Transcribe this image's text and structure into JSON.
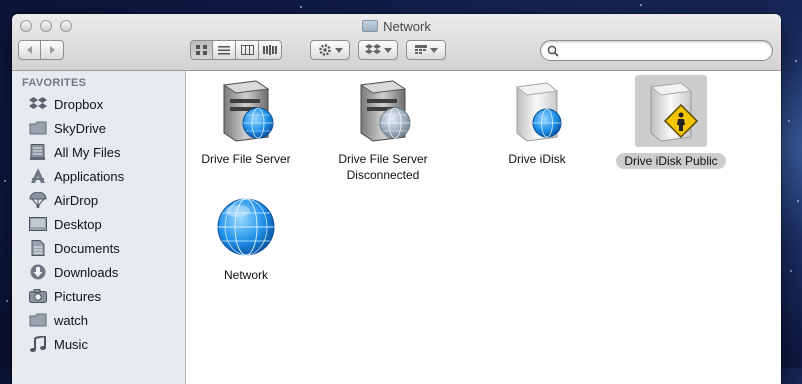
{
  "window": {
    "title": "Network"
  },
  "toolbar": {
    "back_icon": "chevron-left-icon",
    "forward_icon": "chevron-right-icon",
    "view_modes": [
      "icon-view",
      "list-view",
      "column-view",
      "coverflow-view"
    ],
    "selected_view": "icon-view",
    "action_icon": "gear-icon",
    "dropbox_icon": "dropbox-icon",
    "arrange_icon": "arrange-icon",
    "search": {
      "placeholder": "",
      "value": ""
    }
  },
  "sidebar": {
    "heading": "FAVORITES",
    "items": [
      {
        "label": "Dropbox",
        "icon": "dropbox-icon"
      },
      {
        "label": "SkyDrive",
        "icon": "folder-icon"
      },
      {
        "label": "All My Files",
        "icon": "all-files-icon"
      },
      {
        "label": "Applications",
        "icon": "applications-icon"
      },
      {
        "label": "AirDrop",
        "icon": "airdrop-icon"
      },
      {
        "label": "Desktop",
        "icon": "desktop-icon"
      },
      {
        "label": "Documents",
        "icon": "documents-icon"
      },
      {
        "label": "Downloads",
        "icon": "downloads-icon"
      },
      {
        "label": "Pictures",
        "icon": "pictures-icon"
      },
      {
        "label": "watch",
        "icon": "folder-icon"
      },
      {
        "label": "Music",
        "icon": "music-icon"
      }
    ]
  },
  "files": [
    {
      "name": "Drive File Server",
      "icon": "server-drive-globe-icon"
    },
    {
      "name": "Drive File Server Disconnected",
      "icon": "server-drive-disconnected-icon"
    },
    {
      "name": "Drive iDisk",
      "icon": "idisk-drive-icon"
    },
    {
      "name": "Drive iDisk Public",
      "icon": "idisk-public-drive-icon",
      "selected": true
    },
    {
      "name": "Network",
      "icon": "network-globe-icon"
    }
  ],
  "colors": {
    "selection": "#cdcdcd",
    "sidebar_bg": "#e7ebf0",
    "globe_blue": "#1e90e8"
  }
}
